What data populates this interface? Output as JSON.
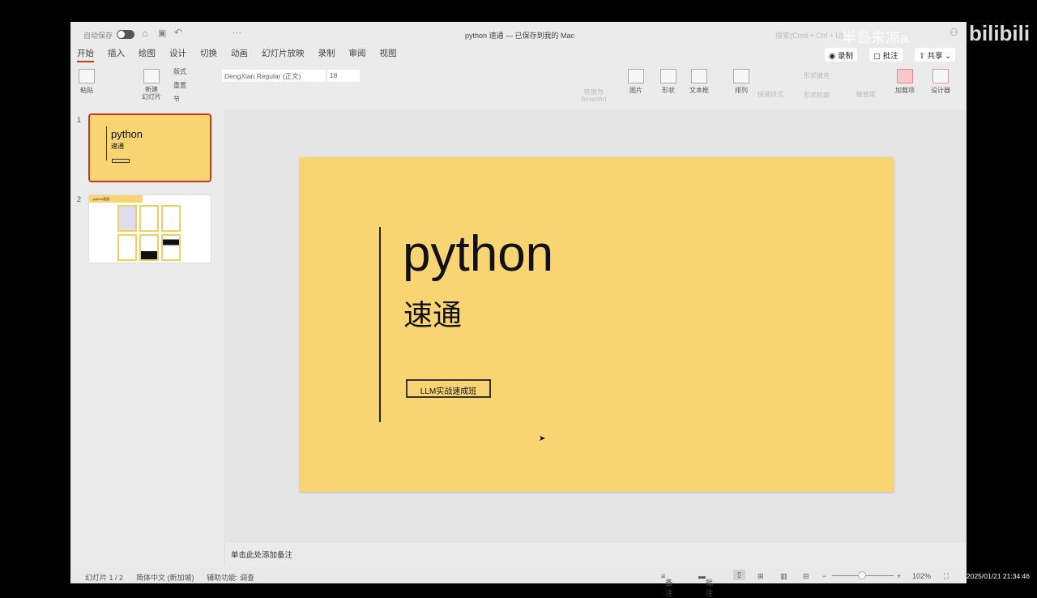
{
  "titlebar": {
    "autosave_label": "自动保存",
    "doc_title": "python 速通 — 已保存到我的 Mac",
    "search_placeholder": "搜索(Cmd + Ctrl + U)",
    "watermark": "半岛未凉a",
    "brand": "bilibili"
  },
  "tabs": [
    "开始",
    "插入",
    "绘图",
    "设计",
    "切换",
    "动画",
    "幻灯片放映",
    "录制",
    "审阅",
    "视图"
  ],
  "actions": {
    "record": "录制",
    "comments": "批注",
    "share": "共享"
  },
  "ribbon": {
    "paste": "粘贴",
    "new_slide": "新建\n幻灯片",
    "layout": "版式",
    "reset": "重置",
    "section": "节",
    "font": "DengXian Regular (正文)",
    "size": "18",
    "convert_smartart": "转换为\nSmartArt",
    "picture": "图片",
    "shapes": "形状",
    "textbox": "文本框",
    "arrange": "排列",
    "quick_styles": "快速样式",
    "shape_fill": "形状填充",
    "shape_outline": "形状轮廓",
    "sensitivity": "敏感度",
    "addins": "加载项",
    "designer": "设计器"
  },
  "slides": [
    {
      "num": "1",
      "title": "python",
      "subtitle": "速通"
    },
    {
      "num": "2",
      "title": "python速通"
    }
  ],
  "slide": {
    "title": "python",
    "subtitle": "速通",
    "tag": "LLM实战速成班"
  },
  "notes_placeholder": "单击此处添加备注",
  "status": {
    "slide_count": "幻灯片 1 / 2",
    "language": "简体中文 (新加坡)",
    "accessibility": "辅助功能: 调查",
    "notes": "备注",
    "comments": "批注",
    "zoom": "102%",
    "timestamp": "2025/01/21 21:34:46"
  },
  "colors": {
    "slide_bg": "#f9d473",
    "accent": "#c43e1c"
  }
}
